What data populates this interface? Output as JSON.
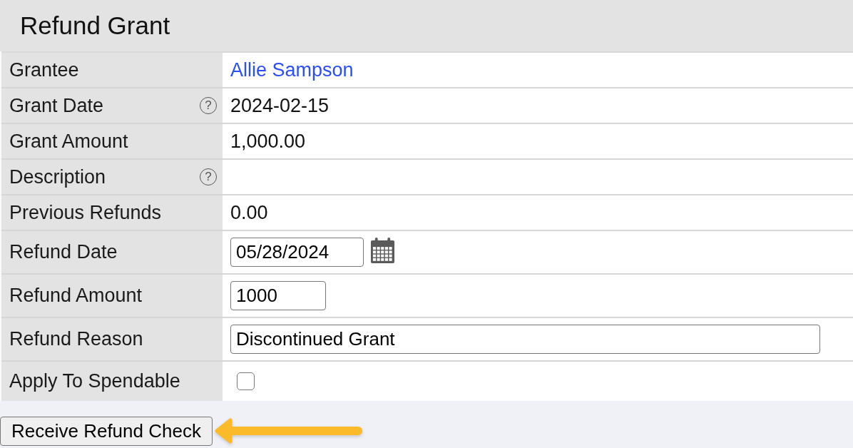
{
  "title": "Refund Grant",
  "fields": [
    {
      "kind": "link",
      "label": "Grantee",
      "value": "Allie Sampson"
    },
    {
      "kind": "text",
      "label": "Grant Date",
      "help": "?",
      "value": "2024-02-15"
    },
    {
      "kind": "text",
      "label": "Grant Amount",
      "value": "1,000.00"
    },
    {
      "kind": "text",
      "label": "Description",
      "help": "?"
    },
    {
      "kind": "text",
      "label": "Previous Refunds",
      "value": "0.00"
    },
    {
      "kind": "date_input",
      "label": "Refund Date",
      "value": "05/28/2024"
    },
    {
      "kind": "number_input",
      "label": "Refund Amount",
      "value": "1000"
    },
    {
      "kind": "text_input",
      "label": "Refund Reason",
      "value": "Discontinued Grant"
    },
    {
      "kind": "checkbox",
      "label": "Apply To Spendable",
      "checked": false
    }
  ],
  "submit_button": "Receive Refund Check"
}
